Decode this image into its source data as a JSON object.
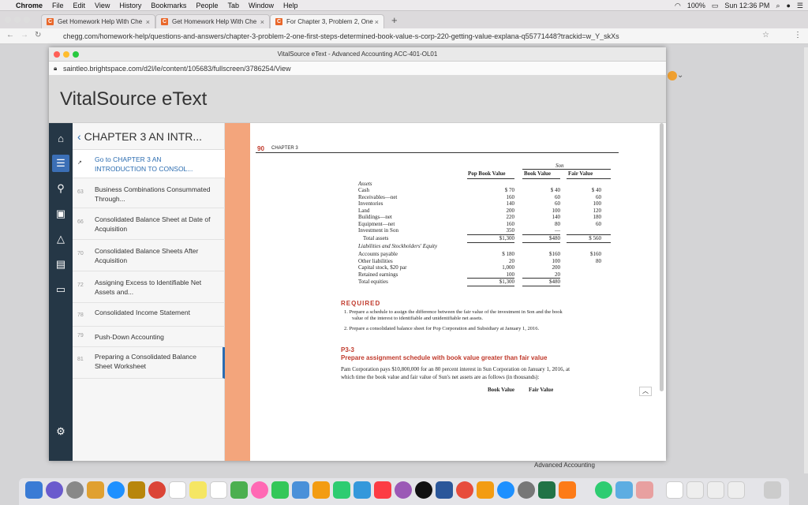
{
  "menubar": {
    "items": [
      "Chrome",
      "File",
      "Edit",
      "View",
      "History",
      "Bookmarks",
      "People",
      "Tab",
      "Window",
      "Help"
    ],
    "battery": "100%",
    "clock": "Sun 12:36 PM"
  },
  "tabs": [
    {
      "label": "Get Homework Help With Che",
      "close": "×"
    },
    {
      "label": "Get Homework Help With Che",
      "close": "×"
    },
    {
      "label": "For Chapter 3, Problem 2, One",
      "close": "×"
    }
  ],
  "new_tab": "+",
  "address": "chegg.com/homework-help/questions-and-answers/chapter-3-problem-2-one-first-steps-determined-book-value-s-corp-220-getting-value-explana-q55771448?trackid=w_Y_skXs",
  "vs": {
    "window_title": "VitalSource eText - Advanced Accounting ACC-401-OL01",
    "url": "saintleo.brightspace.com/d2l/le/content/105683/fullscreen/3786254/View",
    "brand": "VitalSource eText",
    "toc_header": "CHAPTER 3 AN INTR...",
    "toc": [
      {
        "page": "",
        "label": "Go to CHAPTER 3 AN INTRODUCTION TO CONSOL..."
      },
      {
        "page": "63",
        "label": "Business Combinations Consummated Through..."
      },
      {
        "page": "66",
        "label": "Consolidated Balance Sheet at Date of Acquisition"
      },
      {
        "page": "70",
        "label": "Consolidated Balance Sheets After Acquisition"
      },
      {
        "page": "72",
        "label": "Assigning Excess to Identifiable Net Assets and..."
      },
      {
        "page": "78",
        "label": "Consolidated Income Statement"
      },
      {
        "page": "79",
        "label": "Push-Down Accounting"
      },
      {
        "page": "81",
        "label": "Preparing a Consolidated Balance Sheet Worksheet"
      }
    ]
  },
  "book": {
    "page_no": "90",
    "chapter": "CHAPTER 3",
    "son_header": "Son",
    "col_pop": "Pop Book Value",
    "col_son_bv": "Book Value",
    "col_son_fv": "Fair Value",
    "rows": [
      {
        "label": "Assets",
        "pop": "",
        "bv": "",
        "fv": "",
        "italic": true
      },
      {
        "label": "Cash",
        "pop": "$ 70",
        "bv": "$ 40",
        "fv": "$  40"
      },
      {
        "label": "Receivables—net",
        "pop": "160",
        "bv": "60",
        "fv": "60"
      },
      {
        "label": "Inventories",
        "pop": "140",
        "bv": "60",
        "fv": "100"
      },
      {
        "label": "Land",
        "pop": "200",
        "bv": "100",
        "fv": "120"
      },
      {
        "label": "Buildings—net",
        "pop": "220",
        "bv": "140",
        "fv": "180"
      },
      {
        "label": "Equipment—net",
        "pop": "160",
        "bv": "80",
        "fv": "60"
      },
      {
        "label": "Investment in Son",
        "pop": "350",
        "bv": "—",
        "fv": ""
      },
      {
        "label": "Total assets",
        "pop": "$1,300",
        "bv": "$480",
        "fv": "$ 560"
      },
      {
        "label": "Liabilities and Stockholders' Equity",
        "pop": "",
        "bv": "",
        "fv": "",
        "italic": true
      },
      {
        "label": "Accounts payable",
        "pop": "$ 180",
        "bv": "$160",
        "fv": "$160"
      },
      {
        "label": "Other liabilities",
        "pop": "20",
        "bv": "100",
        "fv": "80"
      },
      {
        "label": "Capital stock, $20 par",
        "pop": "1,000",
        "bv": "200",
        "fv": ""
      },
      {
        "label": "Retained earnings",
        "pop": "100",
        "bv": "20",
        "fv": ""
      },
      {
        "label": "Total equities",
        "pop": "$1,300",
        "bv": "$480",
        "fv": ""
      }
    ],
    "required": "REQUIRED",
    "req1": "1.  Prepare a schedule to assign the difference between the fair value of the investment in Son and the book",
    "req1b": "value of the interest to identifiable and unidentifiable net assets.",
    "req2": "2.  Prepare a consolidated balance sheet for Pop Corporation and Subsidiary at January 1, 2016.",
    "p_num": "P3-3",
    "p_title": "Prepare assignment schedule with book value greater than fair value",
    "p_text1": "Pam Corporation pays $10,800,000 for an 80 percent interest in Sun Corporation on January 1, 2016, at",
    "p_text2": "which time the book value and fair value of Sun's net assets are as follows (in thousands):",
    "p_col1": "Book Value",
    "p_col2": "Fair Value"
  },
  "dock_label": "Advanced Accounting"
}
